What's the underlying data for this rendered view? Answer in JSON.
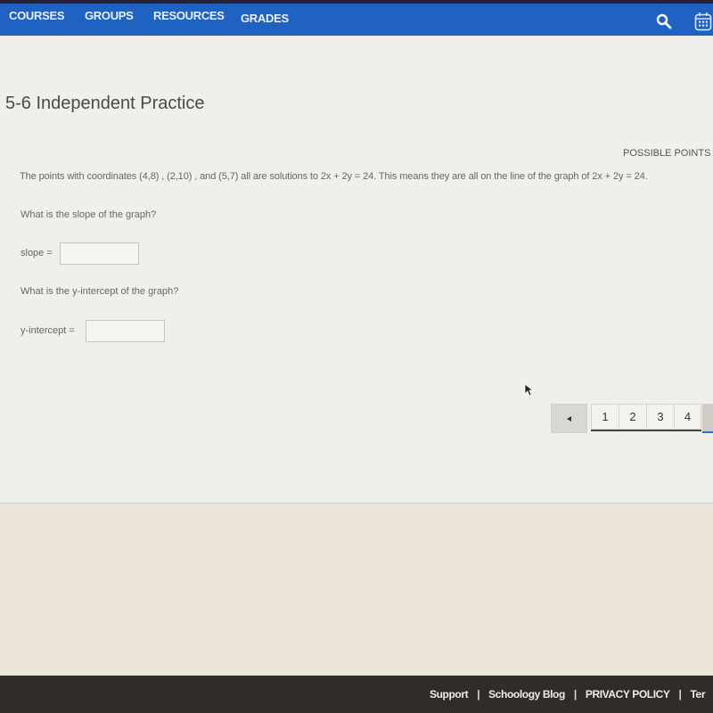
{
  "nav": {
    "items": [
      "COURSES",
      "GROUPS",
      "RESOURCES",
      "GRADES"
    ],
    "icons": [
      "search-icon",
      "calendar-icon"
    ],
    "color": "#1f62c2"
  },
  "page": {
    "title": "5-6 Independent Practice",
    "possible_points_label": "POSSIBLE POINTS",
    "prompt": "The points with coordinates (4,8) , (2,10) , and (5,7) all are solutions to 2x + 2y = 24. This means they are all on the line of the graph of 2x + 2y = 24.",
    "questions": [
      {
        "text": "What is the slope of the graph?",
        "answer_label": "slope =",
        "value": ""
      },
      {
        "text": "What is the y-intercept of the graph?",
        "answer_label": "y-intercept =",
        "value": ""
      }
    ]
  },
  "pager": {
    "prev_icon": "triangle-left-icon",
    "pages": [
      "1",
      "2",
      "3",
      "4"
    ]
  },
  "footer": {
    "links": [
      "Support",
      "Schoology Blog",
      "PRIVACY POLICY",
      "Ter"
    ],
    "separator": "|"
  }
}
